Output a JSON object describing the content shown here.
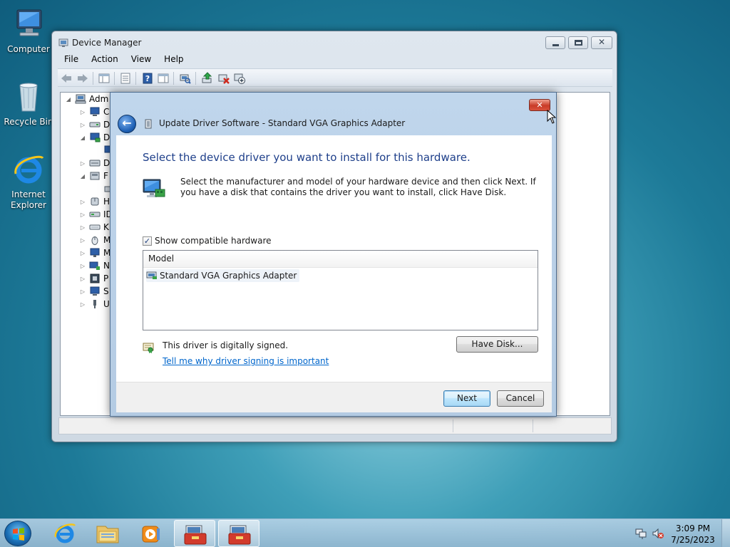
{
  "desktop": {
    "icons": [
      {
        "label": "Computer",
        "icon": "computer-icon"
      },
      {
        "label": "Recycle Bin",
        "icon": "recycle-bin-icon"
      },
      {
        "label": "Internet Explorer",
        "icon": "internet-explorer-icon"
      }
    ]
  },
  "device_manager": {
    "title": "Device Manager",
    "menu": [
      "File",
      "Action",
      "View",
      "Help"
    ],
    "toolbar_icons": [
      "back-arrow-icon",
      "forward-arrow-icon",
      "properties-pane-icon",
      "list-view-icon",
      "help-icon",
      "action-pane-icon",
      "scan-hardware-icon",
      "update-driver-icon",
      "uninstall-icon",
      "disable-device-icon"
    ],
    "tree": [
      {
        "label": "Adm",
        "expander": "◢"
      },
      {
        "label": "C",
        "expander": "▷"
      },
      {
        "label": "D",
        "expander": "▷"
      },
      {
        "label": "D",
        "expander": "◢"
      },
      {
        "label": "",
        "expander": ""
      },
      {
        "label": "D",
        "expander": "▷"
      },
      {
        "label": "F",
        "expander": "◢"
      },
      {
        "label": "",
        "expander": ""
      },
      {
        "label": "H",
        "expander": "▷"
      },
      {
        "label": "ID",
        "expander": "▷"
      },
      {
        "label": "K",
        "expander": "▷"
      },
      {
        "label": "M",
        "expander": "▷"
      },
      {
        "label": "M",
        "expander": "▷"
      },
      {
        "label": "N",
        "expander": "▷"
      },
      {
        "label": "P",
        "expander": "▷"
      },
      {
        "label": "S",
        "expander": "▷"
      },
      {
        "label": "U",
        "expander": "▷"
      }
    ]
  },
  "dialog": {
    "title": "Update Driver Software - Standard VGA Graphics Adapter",
    "close_label": "✕",
    "instruction": "Select the device driver you want to install for this hardware.",
    "description": "Select the manufacturer and model of your hardware device and then click Next. If you have a disk that contains the driver you want to install, click Have Disk.",
    "show_compatible_label": "Show compatible hardware",
    "show_compatible_checked": true,
    "list_header": "Model",
    "models": [
      "Standard VGA Graphics Adapter"
    ],
    "signed_text": "This driver is digitally signed.",
    "signing_link": "Tell me why driver signing is important",
    "have_disk_label": "Have Disk...",
    "next_label": "Next",
    "cancel_label": "Cancel"
  },
  "taskbar": {
    "pinned": [
      "internet-explorer-icon",
      "windows-explorer-icon",
      "media-player-icon",
      "toolbox-app-icon",
      "toolbox-app-icon"
    ],
    "time": "3:09 PM",
    "date": "7/25/2023"
  },
  "colors": {
    "instruction": "#1e3f8a",
    "link": "#0066cc",
    "close_red": "#c93b27"
  }
}
